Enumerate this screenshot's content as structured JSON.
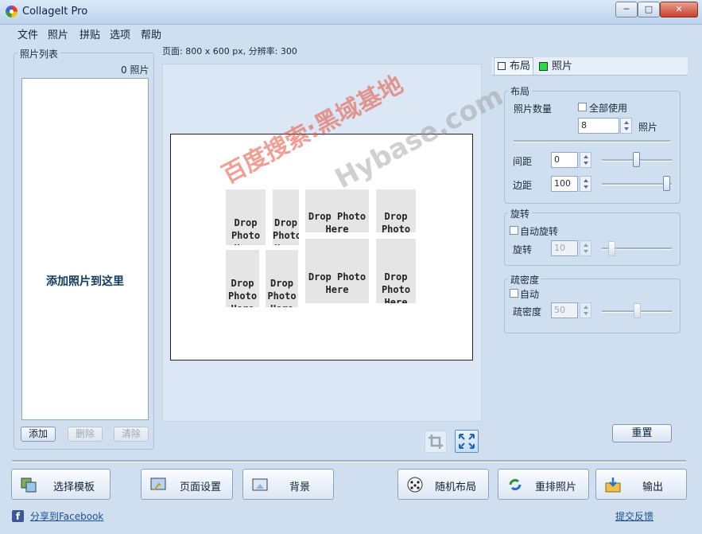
{
  "window": {
    "title": "CollageIt Pro"
  },
  "menu": [
    "文件",
    "照片",
    "拼贴",
    "选项",
    "帮助"
  ],
  "photo_list": {
    "label": "照片列表",
    "count": "0 照片",
    "drop_text": "添加照片到这里",
    "add": "添加",
    "delete": "删除",
    "clear": "清除"
  },
  "page_info": "页面: 800 x 600 px, 分辨率: 300",
  "slots": [
    "Drop Photo Here",
    "Drop Photo Here",
    "Drop Photo Here",
    "Drop Photo",
    "Drop Photo Here",
    "Drop Photo Here",
    "Drop Photo Here",
    "Drop Photo Here"
  ],
  "tabs": {
    "layout": "布局",
    "photo": "照片"
  },
  "layout_group": {
    "title": "布局",
    "photo_count_label": "照片数量",
    "use_all_label": "全部使用",
    "photo_count_value": "8",
    "photo_unit": "照片",
    "spacing_label": "间距",
    "spacing_value": "0",
    "margin_label": "边距",
    "margin_value": "100"
  },
  "rotation_group": {
    "title": "旋转",
    "auto_label": "自动旋转",
    "rotation_label": "旋转",
    "rotation_value": "10"
  },
  "density_group": {
    "title": "疏密度",
    "auto_label": "自动",
    "density_label": "疏密度",
    "density_value": "50"
  },
  "reset": "重置",
  "bottom_buttons": {
    "template": "选择模板",
    "page_setup": "页面设置",
    "background": "背景",
    "random_layout": "随机布局",
    "shuffle": "重排照片",
    "export": "输出"
  },
  "share_link": "分享到Facebook",
  "feedback_link": "提交反馈",
  "watermark": {
    "cn": "百度搜索:黑域基地",
    "en": "Hybase.com"
  }
}
